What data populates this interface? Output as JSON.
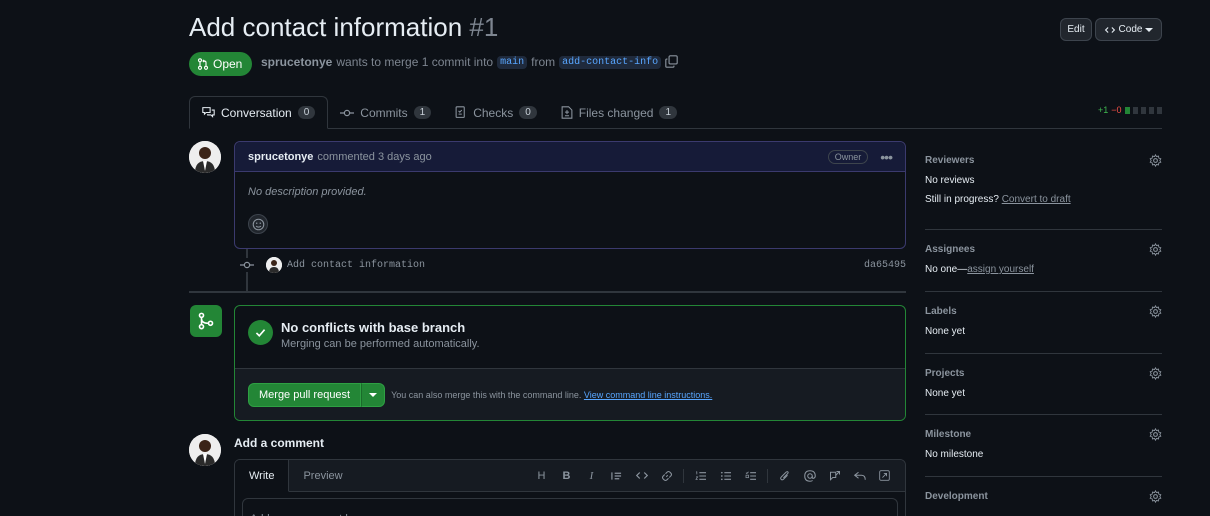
{
  "pr": {
    "title": "Add contact information",
    "number": "#1",
    "state": "Open",
    "author": "sprucetonye",
    "meta_mid": "wants to merge 1 commit into",
    "base_branch": "main",
    "meta_from": "from",
    "head_branch": "add-contact-info"
  },
  "header_buttons": {
    "edit": "Edit",
    "code": "Code"
  },
  "tabs": [
    {
      "label": "Conversation",
      "count": "0"
    },
    {
      "label": "Commits",
      "count": "1"
    },
    {
      "label": "Checks",
      "count": "0"
    },
    {
      "label": "Files changed",
      "count": "1"
    }
  ],
  "diffstat": {
    "additions": "+1",
    "deletions": "−0"
  },
  "comment": {
    "author": "sprucetonye",
    "action": "commented 3 days ago",
    "badge": "Owner",
    "body": "No description provided."
  },
  "commit": {
    "message": "Add contact information",
    "sha": "da65495"
  },
  "merge": {
    "title": "No conflicts with base branch",
    "subtitle": "Merging can be performed automatically.",
    "button": "Merge pull request",
    "hint": "You can also merge this with the command line.",
    "hint_link": "View command line instructions."
  },
  "add_comment": {
    "title": "Add a comment",
    "tab_write": "Write",
    "tab_preview": "Preview",
    "placeholder": "Add your comment here..."
  },
  "sidebar": {
    "reviewers": {
      "title": "Reviewers",
      "value": "No reviews",
      "sub": "Still in progress?",
      "sub_link": "Convert to draft"
    },
    "assignees": {
      "title": "Assignees",
      "value": "No one—",
      "link": "assign yourself"
    },
    "labels": {
      "title": "Labels",
      "value": "None yet"
    },
    "projects": {
      "title": "Projects",
      "value": "None yet"
    },
    "milestone": {
      "title": "Milestone",
      "value": "No milestone"
    },
    "development": {
      "title": "Development"
    }
  },
  "colors": {
    "accent_green": "#238636",
    "link_blue": "#58a6ff",
    "bg": "#0d1117"
  }
}
